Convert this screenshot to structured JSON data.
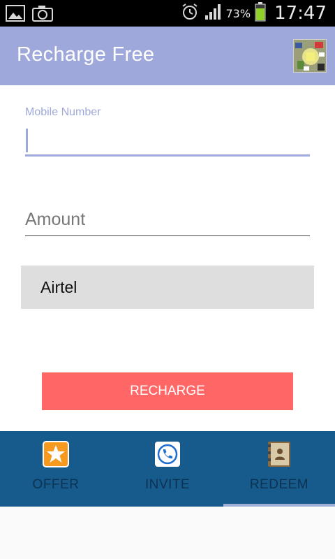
{
  "status_bar": {
    "left_icons": [
      "image-icon",
      "camera-icon"
    ],
    "right_icons": [
      "alarm-icon",
      "signal-icon",
      "battery-icon"
    ],
    "battery_percent": "73%",
    "time": "17:47"
  },
  "app_bar": {
    "title": "Recharge Free",
    "icon": "app-logo-icon"
  },
  "form": {
    "mobile_label": "Mobile Number",
    "mobile_value": "",
    "amount_placeholder": "Amount",
    "amount_value": "",
    "operator_value": "Airtel",
    "recharge_label": "RECHARGE"
  },
  "tabs": [
    {
      "label": "OFFER",
      "icon": "star-icon",
      "selected": false
    },
    {
      "label": "INVITE",
      "icon": "phone-icon",
      "selected": false
    },
    {
      "label": "REDEEM",
      "icon": "contacts-book-icon",
      "selected": true
    }
  ],
  "colors": {
    "accent": "#9fa8da",
    "button": "#ff6666",
    "tab_bar": "#175a8c",
    "tab_text": "#0b3252"
  }
}
